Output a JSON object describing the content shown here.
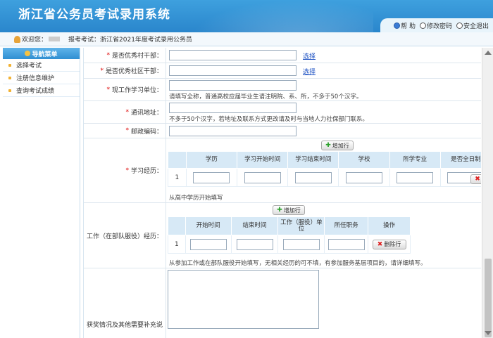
{
  "header": {
    "title": "浙江省公务员考试录用系统",
    "help": "帮 助",
    "change_password": "修改密码",
    "logout": "安全退出"
  },
  "subbar": {
    "welcome": "欢迎您：",
    "exam_prefix": "报考考试：",
    "exam_name": "浙江省2021年度考试录用公务员"
  },
  "sidebar": {
    "title": "导航菜单",
    "items": [
      {
        "label": "选择考试"
      },
      {
        "label": "注册信息维护"
      },
      {
        "label": "查询考试成绩"
      }
    ]
  },
  "form": {
    "excellent_village": {
      "label": "是否优秀村干部：",
      "link": "选择"
    },
    "excellent_community": {
      "label": "是否优秀社区干部：",
      "link": "选择"
    },
    "workplace": {
      "label": "现工作学习单位：",
      "hint": "请填写全称，普通高校应届毕业生请注明院、系、所，不多于50个汉字。"
    },
    "address": {
      "label": "通讯地址：",
      "hint": "不多于50个汉字，若地址及联系方式更改请及时与当地人力社保部门联系。"
    },
    "postcode": {
      "label": "邮政编码："
    },
    "education": {
      "label": "学习经历：",
      "add_button": "增加行",
      "columns": [
        "学历",
        "学习开始时间",
        "学习结束时间",
        "学校",
        "所学专业",
        "是否全日制"
      ],
      "row_number": "1",
      "hint": "从高中学历开始填写"
    },
    "work": {
      "label": "工作（在部队服役）经历：",
      "add_button": "增加行",
      "columns": [
        "开始时间",
        "结束时间",
        "工作（服役）单位",
        "所任职务",
        "操作"
      ],
      "row_number": "1",
      "delete_button": "删除行",
      "hint": "从参加工作或在部队服役开始填写，无相关经历的可不填，有参加服务基层项目的，请详细填写。"
    },
    "awards": {
      "label": "获奖情况及其他需要补充说"
    }
  },
  "colors": {
    "header": "#2a86cc",
    "table_header": "#d7e9f6",
    "required": "#dd0000",
    "link": "#1a4fc2"
  }
}
